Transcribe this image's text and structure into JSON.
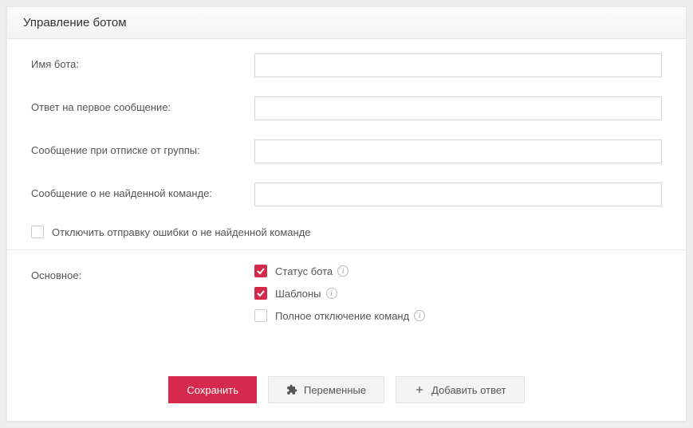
{
  "header": {
    "title": "Управление ботом"
  },
  "fields": {
    "botName": {
      "label": "Имя бота:",
      "value": ""
    },
    "firstReply": {
      "label": "Ответ на первое сообщение:",
      "value": ""
    },
    "unsubscribeMsg": {
      "label": "Сообщение при отписке от группы:",
      "value": ""
    },
    "notFoundMsg": {
      "label": "Сообщение о не найденной команде:",
      "value": ""
    }
  },
  "disableErrorCheckbox": {
    "label": "Отключить отправку ошибки о не найденной команде",
    "checked": false
  },
  "mainSection": {
    "label": "Основное:",
    "options": {
      "status": {
        "label": "Статус бота",
        "checked": true
      },
      "templates": {
        "label": "Шаблоны",
        "checked": true
      },
      "disableCommands": {
        "label": "Полное отключение команд",
        "checked": false
      }
    }
  },
  "buttons": {
    "save": "Сохранить",
    "variables": "Переменные",
    "addReply": "Добавить ответ"
  }
}
